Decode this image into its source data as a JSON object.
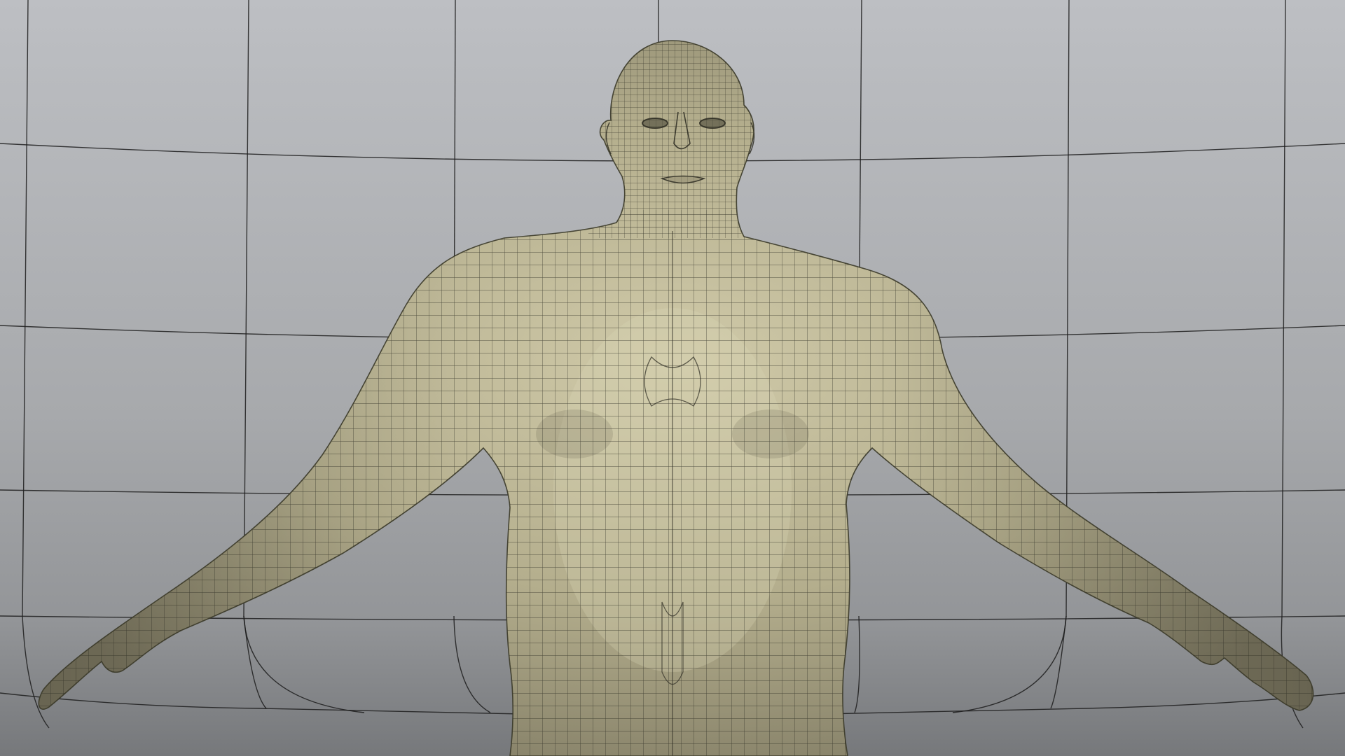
{
  "scene": {
    "subject": "t-pose-human-base-mesh",
    "display_mode": "wireframe-on-shaded",
    "colors": {
      "backdrop_top": "#bcbec2",
      "backdrop_mid": "#a6a8ab",
      "backdrop_bottom": "#797b7e",
      "backdrop_grid_line": "#1c1c1c",
      "body_fill": "#b1ab8a",
      "body_highlight": "#cfc9a8",
      "body_shadow": "#7d7862",
      "mesh_wire": "#2b2a21"
    }
  }
}
